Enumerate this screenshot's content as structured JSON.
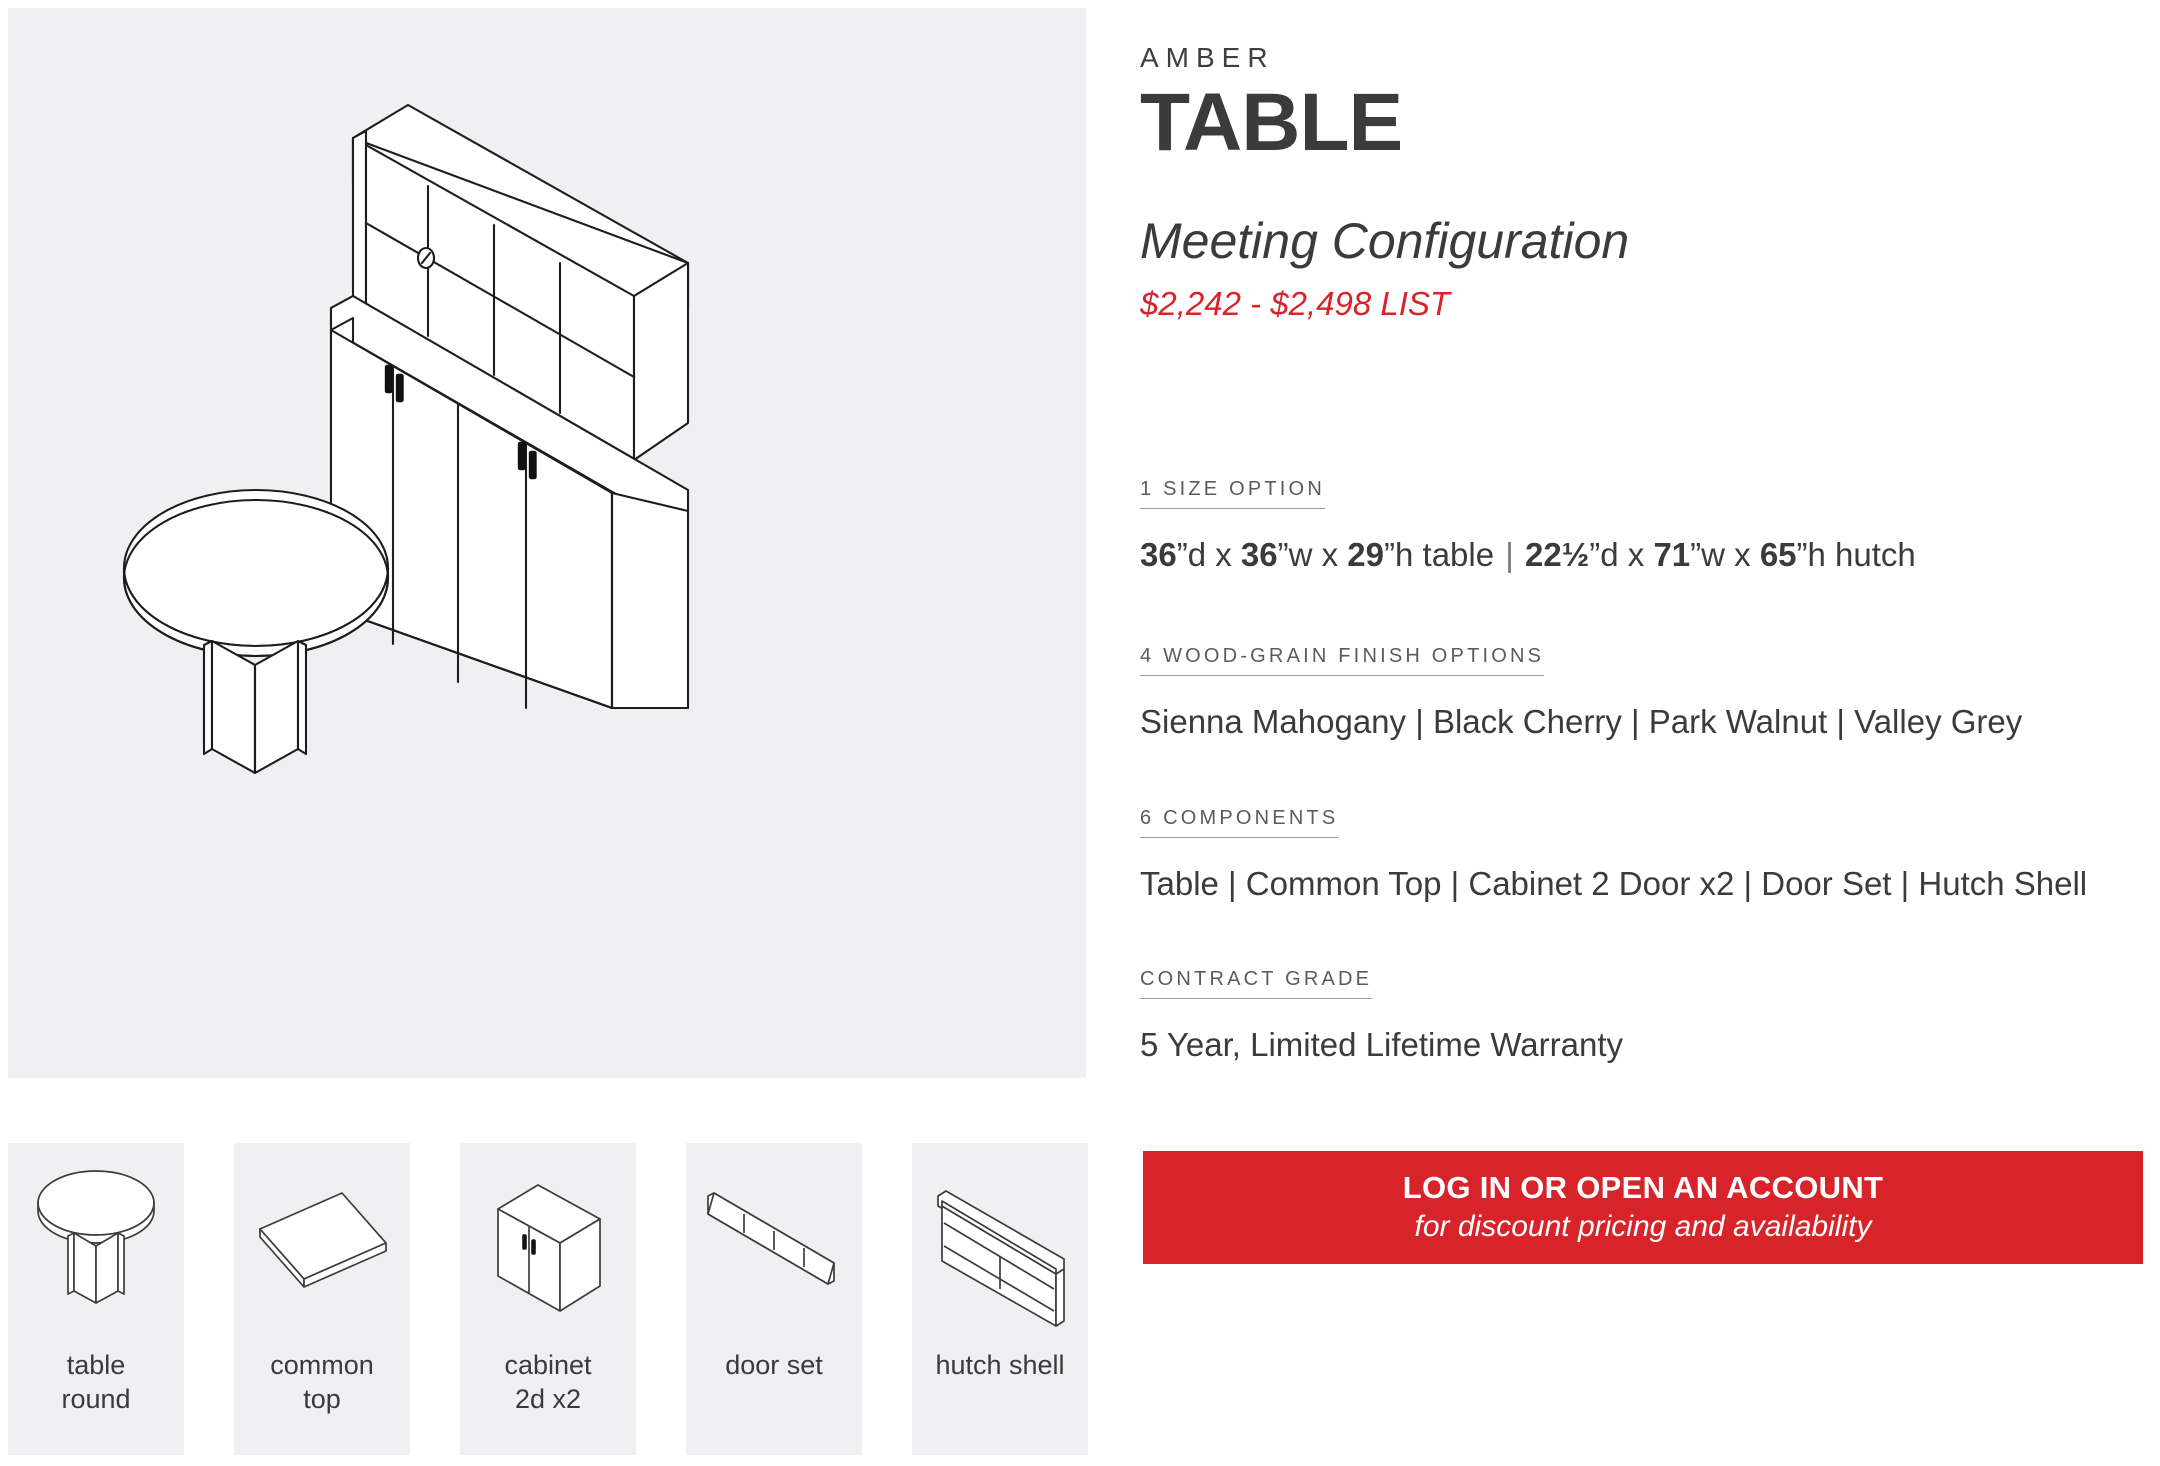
{
  "product": {
    "brand": "AMBER",
    "title": "TABLE",
    "subtitle": "Meeting Configuration",
    "price_range": "$2,242 - $2,498 LIST"
  },
  "specs": [
    {
      "label": "1 SIZE OPTION",
      "value": "36”d x 36”w x 29”h table | 22½”d x 71”w x 65”h hutch",
      "parts": [
        {
          "t": "36",
          "b": true
        },
        {
          "t": "”d x ",
          "b": false
        },
        {
          "t": "36",
          "b": true
        },
        {
          "t": "”w x ",
          "b": false
        },
        {
          "t": "29",
          "b": true
        },
        {
          "t": "”h table ",
          "b": false
        },
        {
          "t": "|",
          "sep": true
        },
        {
          "t": " 22½",
          "b": true
        },
        {
          "t": "”d x ",
          "b": false
        },
        {
          "t": "71",
          "b": true
        },
        {
          "t": "”w x ",
          "b": false
        },
        {
          "t": "65",
          "b": true
        },
        {
          "t": "”h hutch",
          "b": false
        }
      ]
    },
    {
      "label": "4 WOOD-GRAIN FINISH OPTIONS",
      "value": "Sienna Mahogany | Black Cherry | Park Walnut | Valley Grey",
      "items": [
        "Sienna Mahogany",
        "Black Cherry",
        "Park Walnut",
        "Valley Grey"
      ]
    },
    {
      "label": "6 COMPONENTS",
      "value": "Table | Common Top | Cabinet 2 Door x2 | Door Set | Hutch Shell",
      "items": [
        "Table",
        "Common Top",
        "Cabinet 2 Door x2",
        "Door Set",
        "Hutch Shell"
      ]
    },
    {
      "label": "CONTRACT GRADE",
      "value": "5 Year, Limited Lifetime Warranty"
    }
  ],
  "cta": {
    "main": "LOG IN OR OPEN AN ACCOUNT",
    "sub": "for discount pricing and availability"
  },
  "components": [
    {
      "label": "table\nround",
      "icon": "round-table-icon"
    },
    {
      "label": "common\ntop",
      "icon": "common-top-icon"
    },
    {
      "label": "cabinet\n2d x2",
      "icon": "cabinet-2-door-icon"
    },
    {
      "label": "door set",
      "icon": "door-set-icon"
    },
    {
      "label": "hutch shell",
      "icon": "hutch-shell-icon"
    }
  ],
  "hero": {
    "alt": "Isometric line drawing of round meeting table with credenza and hutch"
  },
  "colors": {
    "accent_red": "#d8232a",
    "panel_gray": "#f0f0f2",
    "text_dark": "#3b3b3d",
    "label_gray": "#5b5b5d"
  }
}
